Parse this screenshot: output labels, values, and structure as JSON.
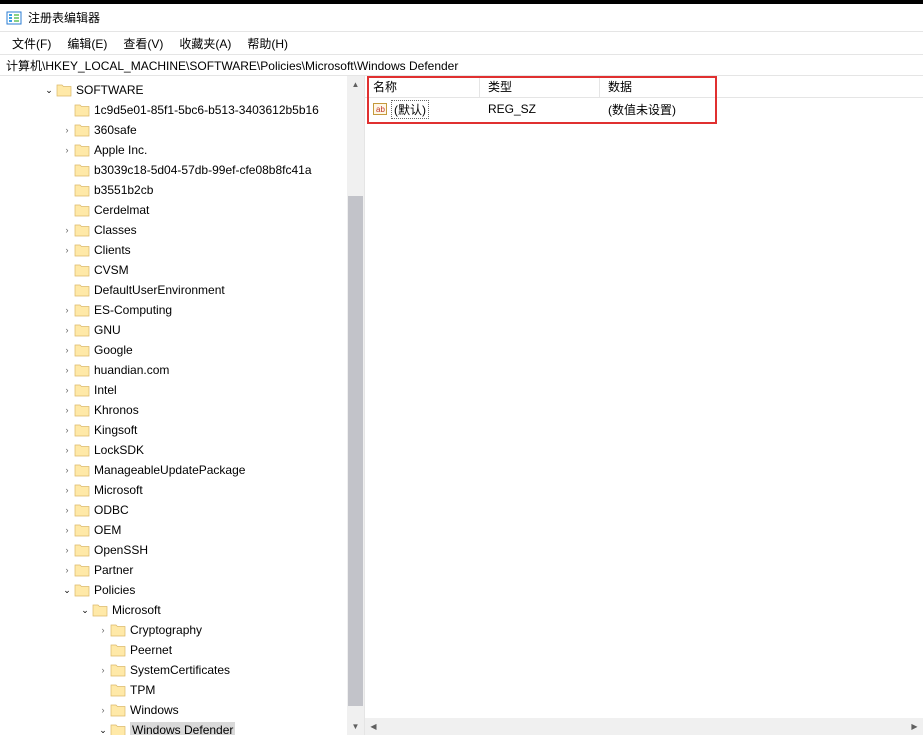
{
  "window": {
    "title": "注册表编辑器"
  },
  "menu": {
    "file": "文件(F)",
    "edit": "编辑(E)",
    "view": "查看(V)",
    "favorites": "收藏夹(A)",
    "help": "帮助(H)"
  },
  "address": {
    "path": "计算机\\HKEY_LOCAL_MACHINE\\SOFTWARE\\Policies\\Microsoft\\Windows Defender"
  },
  "tree": {
    "root": {
      "label": "SOFTWARE",
      "expanded": true,
      "children": [
        {
          "label": "1c9d5e01-85f1-5bc6-b513-3403612b5b16",
          "expandable": false
        },
        {
          "label": "360safe",
          "expandable": true
        },
        {
          "label": "Apple Inc.",
          "expandable": true
        },
        {
          "label": "b3039c18-5d04-57db-99ef-cfe08b8fc41a",
          "expandable": false
        },
        {
          "label": "b3551b2cb",
          "expandable": false
        },
        {
          "label": "Cerdelmat",
          "expandable": false
        },
        {
          "label": "Classes",
          "expandable": true
        },
        {
          "label": "Clients",
          "expandable": true
        },
        {
          "label": "CVSM",
          "expandable": false
        },
        {
          "label": "DefaultUserEnvironment",
          "expandable": false
        },
        {
          "label": "ES-Computing",
          "expandable": true
        },
        {
          "label": "GNU",
          "expandable": true
        },
        {
          "label": "Google",
          "expandable": true
        },
        {
          "label": "huandian.com",
          "expandable": true
        },
        {
          "label": "Intel",
          "expandable": true
        },
        {
          "label": "Khronos",
          "expandable": true
        },
        {
          "label": "Kingsoft",
          "expandable": true
        },
        {
          "label": "LockSDK",
          "expandable": true
        },
        {
          "label": "ManageableUpdatePackage",
          "expandable": true
        },
        {
          "label": "Microsoft",
          "expandable": true
        },
        {
          "label": "ODBC",
          "expandable": true
        },
        {
          "label": "OEM",
          "expandable": true
        },
        {
          "label": "OpenSSH",
          "expandable": true
        },
        {
          "label": "Partner",
          "expandable": true
        },
        {
          "label": "Policies",
          "expandable": true,
          "expanded": true,
          "children": [
            {
              "label": "Microsoft",
              "expandable": true,
              "expanded": true,
              "children": [
                {
                  "label": "Cryptography",
                  "expandable": true
                },
                {
                  "label": "Peernet",
                  "expandable": false
                },
                {
                  "label": "SystemCertificates",
                  "expandable": true
                },
                {
                  "label": "TPM",
                  "expandable": false
                },
                {
                  "label": "Windows",
                  "expandable": true
                },
                {
                  "label": "Windows Defender",
                  "expandable": true,
                  "expanded": true,
                  "selected": true
                }
              ]
            }
          ]
        }
      ]
    }
  },
  "list": {
    "header_name": "名称",
    "header_type": "类型",
    "header_data": "数据",
    "rows": [
      {
        "name": "(默认)",
        "type": "REG_SZ",
        "data": "(数值未设置)"
      }
    ]
  }
}
